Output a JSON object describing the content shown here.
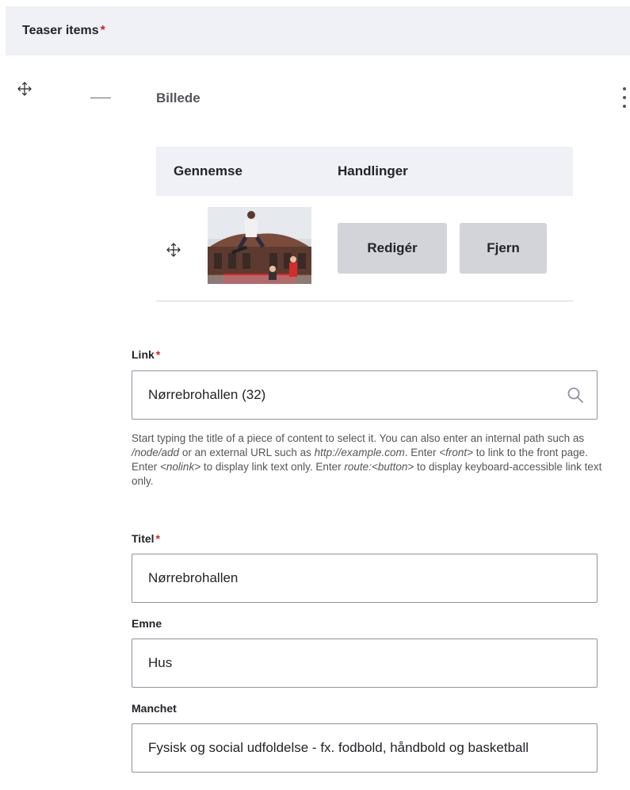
{
  "section": {
    "title": "Teaser items",
    "required_mark": "*"
  },
  "paragraph": {
    "label": "Billede",
    "table": {
      "col_preview": "Gennemse",
      "col_actions": "Handlinger"
    },
    "row": {
      "edit_label": "Redigér",
      "remove_label": "Fjern"
    }
  },
  "fields": {
    "link": {
      "label": "Link",
      "required_mark": "*",
      "value": "Nørrebrohallen (32)",
      "help": {
        "p1": "Start typing the title of a piece of content to select it. You can also enter an internal path such as ",
        "e1": "/node/add",
        "p2": " or an external URL such as ",
        "e2": "http://example.com",
        "p3": ". Enter ",
        "e3": "<front>",
        "p4": " to link to the front page. Enter ",
        "e4": "<nolink>",
        "p5": " to display link text only. Enter ",
        "e5": "route:<button>",
        "p6": " to display keyboard-accessible link text only."
      }
    },
    "titel": {
      "label": "Titel",
      "required_mark": "*",
      "value": "Nørrebrohallen"
    },
    "emne": {
      "label": "Emne",
      "value": "Hus"
    },
    "manchet": {
      "label": "Manchet",
      "value": "Fysisk og social udfoldelse - fx. fodbold, håndbold og basketball"
    }
  },
  "icons": {
    "drag": "move-arrows-icon",
    "menu": "vertical-dots-icon",
    "search": "magnifier-icon"
  },
  "colors": {
    "header_bg": "#f0f1f6",
    "button_bg": "#d3d4d9",
    "required": "#d72222",
    "text": "#232429"
  }
}
